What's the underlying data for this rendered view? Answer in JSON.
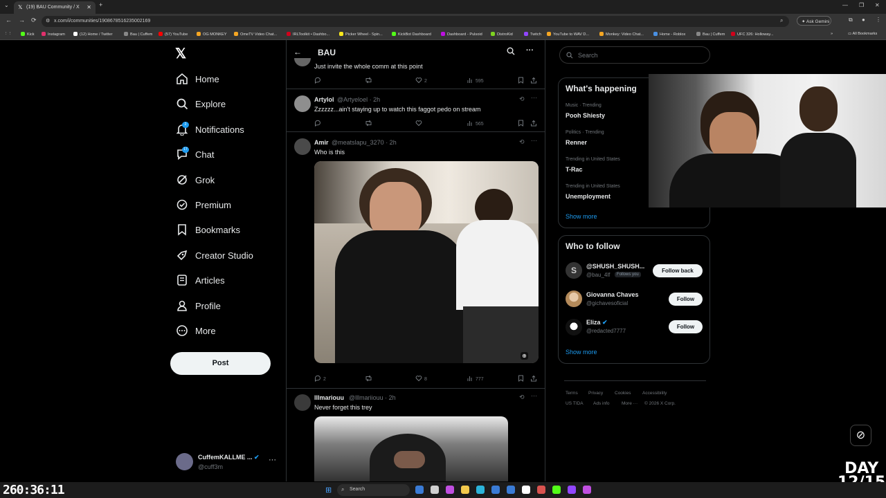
{
  "browser": {
    "tab_title": "(19) BAU Community / X",
    "url": "x.com/i/communities/1908678516235002169",
    "ask_gemini": "Ask Gemini",
    "all_bookmarks": "All Bookmarks",
    "bookmarks": [
      {
        "label": "Kick",
        "color": "#53fc18"
      },
      {
        "label": "Instagram",
        "color": "#e1306c"
      },
      {
        "label": "(12) Home / Twitter",
        "color": "#ffffff"
      },
      {
        "label": "Bau | Cuffem",
        "color": "#888888"
      },
      {
        "label": "(57) YouTube",
        "color": "#ff0000"
      },
      {
        "label": "OG MONKEY",
        "color": "#f5a623"
      },
      {
        "label": "OmeTV Video Chat...",
        "color": "#f5a623"
      },
      {
        "label": "IRLToolkit • Dashbo...",
        "color": "#d0021b"
      },
      {
        "label": "Picker Wheel - Spin...",
        "color": "#f8e71c"
      },
      {
        "label": "KickBot Dashboard",
        "color": "#53fc18"
      },
      {
        "label": "Dashboard - Pulsoid",
        "color": "#bd10e0"
      },
      {
        "label": "DistroKid",
        "color": "#7ed321"
      },
      {
        "label": "Twitch",
        "color": "#9146ff"
      },
      {
        "label": "YouTube to WAV D...",
        "color": "#f5a623"
      },
      {
        "label": "Monkey: Video Chat...",
        "color": "#f5a623"
      },
      {
        "label": "Home - Roblox",
        "color": "#4a90e2"
      },
      {
        "label": "Bau | Cuffem",
        "color": "#888888"
      },
      {
        "label": "UFC 326: Holloway...",
        "color": "#d0021b"
      }
    ]
  },
  "sidebar": {
    "items": [
      {
        "label": "Home",
        "icon": "home-icon"
      },
      {
        "label": "Explore",
        "icon": "search-icon"
      },
      {
        "label": "Notifications",
        "icon": "bell-icon",
        "badge": "2"
      },
      {
        "label": "Chat",
        "icon": "chat-icon",
        "badge": "17"
      },
      {
        "label": "Grok",
        "icon": "grok-icon"
      },
      {
        "label": "Premium",
        "icon": "premium-icon"
      },
      {
        "label": "Bookmarks",
        "icon": "bookmark-icon"
      },
      {
        "label": "Creator Studio",
        "icon": "rocket-icon"
      },
      {
        "label": "Articles",
        "icon": "articles-icon"
      },
      {
        "label": "Profile",
        "icon": "person-icon"
      },
      {
        "label": "More",
        "icon": "more-circle-icon"
      }
    ],
    "post_label": "Post",
    "account": {
      "name": "CuffemKALLME ...",
      "handle": "@cuff3m"
    }
  },
  "feed": {
    "title": "BAU",
    "tweets": [
      {
        "text": "Just invite the whole comm at this point",
        "replies": "",
        "retweets": "",
        "likes": "2",
        "views": "595"
      },
      {
        "name": "Artylol",
        "handle": "@Artyeloel · 2h",
        "text": "Zzzzzz...ain't staying up to watch this faggot pedo on stream",
        "replies": "",
        "retweets": "",
        "likes": "",
        "views": "565"
      },
      {
        "name": "Amir",
        "handle": "@meatslapu_3270 · 2h",
        "text": "Who is this",
        "replies": "2",
        "retweets": "",
        "likes": "8",
        "views": "777"
      },
      {
        "name": "lllmariouu",
        "handle": "@lllmariiouu · 2h",
        "text": "Never forget this trey"
      }
    ]
  },
  "right": {
    "search_placeholder": "Search",
    "whats_happening": "What's happening",
    "trends": [
      {
        "category": "Music · Trending",
        "name": "Pooh Shiesty"
      },
      {
        "category": "Politics · Trending",
        "name": "Renner"
      },
      {
        "category": "Trending in United States",
        "name": "T-Rac"
      },
      {
        "category": "Trending in United States",
        "name": "Unemployment"
      }
    ],
    "show_more": "Show more",
    "who_to_follow": "Who to follow",
    "follows": [
      {
        "name": "@SHUSH_SHUSH...",
        "handle": "@bau_4lf",
        "follows_you": "Follows you",
        "button": "Follow back",
        "avatar_letter": "S"
      },
      {
        "name": "Giovanna Chaves",
        "handle": "@gichavesoficial",
        "button": "Follow"
      },
      {
        "name": "Eliza",
        "handle": "@redacted7777",
        "button": "Follow"
      }
    ],
    "footer": {
      "line1": [
        "Terms",
        "Privacy",
        "Cookies",
        "Accessibility"
      ],
      "line2": [
        "US TIDA",
        "Ads info",
        "More ···",
        "© 2026 X Corp."
      ]
    }
  },
  "overlay": {
    "timer": "260:36:11",
    "day_line1": "DAY",
    "day_line2": "12/15"
  },
  "taskbar": {
    "search": "Search"
  }
}
